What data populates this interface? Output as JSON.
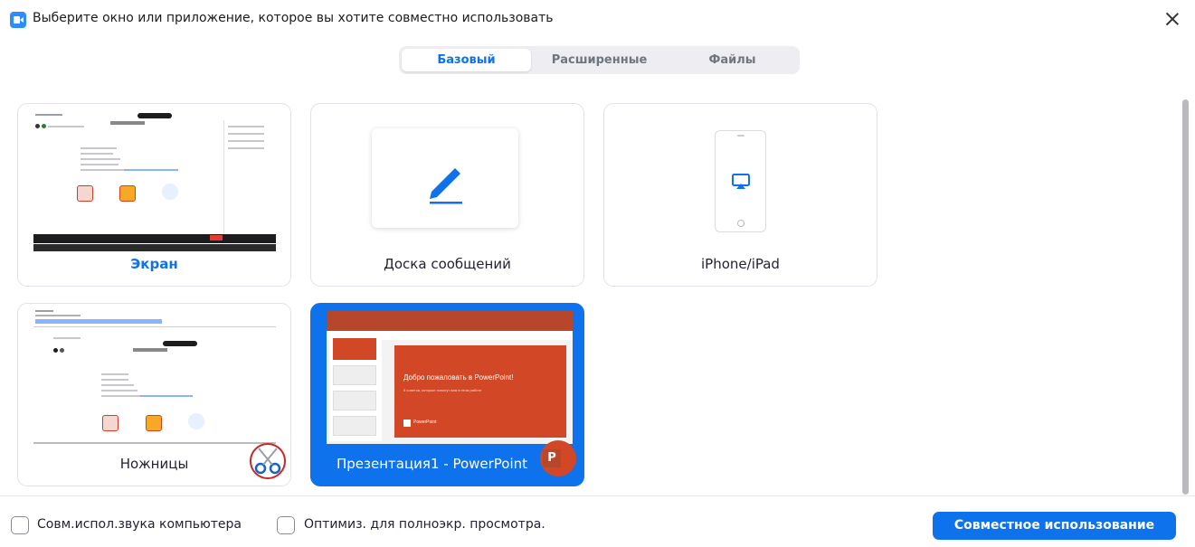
{
  "window": {
    "title": "Выберите окно или приложение, которое вы хотите совместно использовать",
    "icon": "zoom-app-icon"
  },
  "tabs": [
    {
      "label": "Базовый",
      "active": true
    },
    {
      "label": "Расширенные",
      "active": false
    },
    {
      "label": "Файлы",
      "active": false
    }
  ],
  "cards": [
    {
      "label": "Экран",
      "icon": "desktop-screen-thumbnail",
      "selected": false
    },
    {
      "label": "Доска сообщений",
      "icon": "pen-icon",
      "selected": false
    },
    {
      "label": "iPhone/iPad",
      "icon": "airplay-icon",
      "selected": false
    },
    {
      "label": "Ножницы",
      "icon": "snipping-tool-icon",
      "selected": false
    },
    {
      "label": "Презентация1 - PowerPoint",
      "icon": "powerpoint-icon",
      "selected": true
    }
  ],
  "powerpoint_preview": {
    "slide_title": "Добро пожаловать в PowerPoint!",
    "slide_subtitle": "5 советов, которые помогут вам в этом работе",
    "brand": "PowerPoint"
  },
  "footer": {
    "checkbox_audio_label": "Совм.испол.звука компьютера",
    "checkbox_optimize_label": "Оптимиз. для полноэкр. просмотра.",
    "share_button_label": "Совместное использование"
  },
  "colors": {
    "accent": "#0e72ed",
    "selected_card": "#0e72ed",
    "powerpoint": "#d24726"
  }
}
